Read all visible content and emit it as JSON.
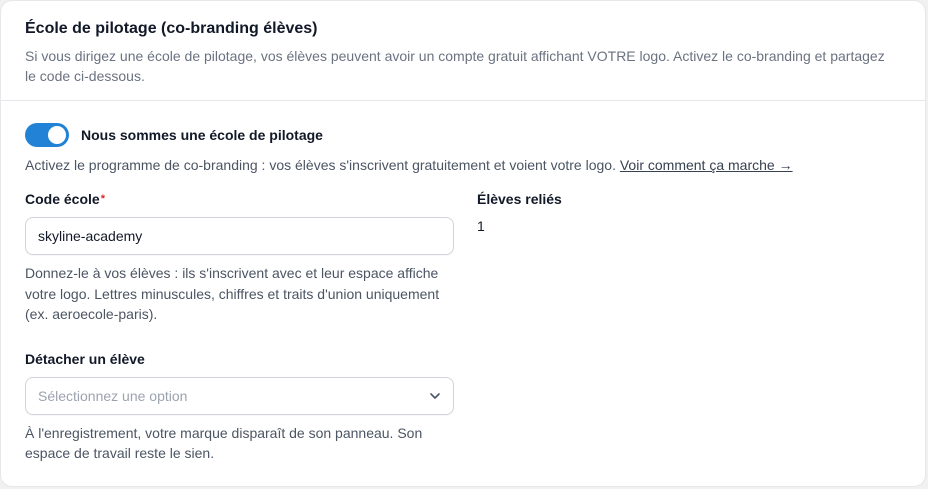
{
  "section": {
    "title": "École de pilotage (co-branding élèves)",
    "subtitle": "Si vous dirigez une école de pilotage, vos élèves peuvent avoir un compte gratuit affichant VOTRE logo. Activez le co-branding et partagez le code ci-dessous."
  },
  "toggle": {
    "label": "Nous sommes une école de pilotage",
    "on": true,
    "accent": "#2283d6"
  },
  "description": {
    "text": "Activez le programme de co-branding : vos élèves s'inscrivent gratuitement et voient votre logo. ",
    "link": "Voir comment ça marche →"
  },
  "school_code": {
    "label": "Code école",
    "required_mark": "*",
    "value": "skyline-academy",
    "help": "Donnez-le à vos élèves : ils s'inscrivent avec et leur espace affiche votre logo. Lettres minuscules, chiffres et traits d'union uniquement (ex. aeroecole-paris)."
  },
  "detach": {
    "label": "Détacher un élève",
    "placeholder": "Sélectionnez une option",
    "help": "À l'enregistrement, votre marque disparaît de son panneau. Son espace de travail reste le sien."
  },
  "linked": {
    "label": "Élèves reliés",
    "count": "1"
  }
}
